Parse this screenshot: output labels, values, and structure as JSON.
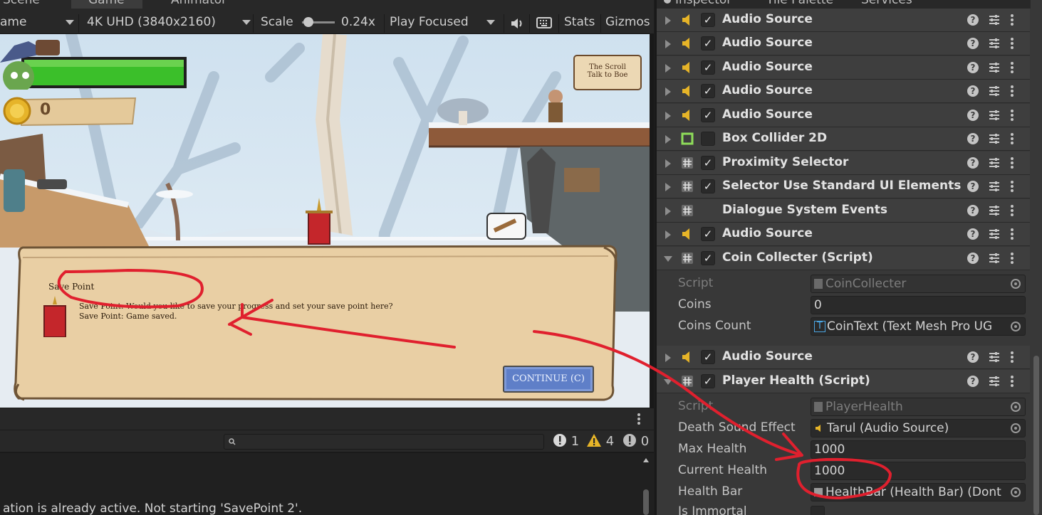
{
  "game_tabs": {
    "scene": "Scene",
    "game": "Game",
    "animator": "Animator"
  },
  "game_toolbar": {
    "display": "ame",
    "resolution": "4K UHD (3840x2160)",
    "scale_label": "Scale",
    "scale_value": "0.24x",
    "play_mode": "Play Focused",
    "stats": "Stats",
    "gizmos": "Gizmos"
  },
  "game_hud": {
    "coins": "0",
    "health_fraction": 1.0
  },
  "game_sign": {
    "line1": "The Scroll",
    "line2": "Talk to Boe"
  },
  "dialogue": {
    "speaker": "Save Point",
    "line1": "Save Point: Would you like to save your progress and set your save point here?",
    "line2": "Save Point: Game saved.",
    "continue": "CONTINUE (C)"
  },
  "console": {
    "counts": {
      "errors": "1",
      "warnings": "4",
      "messages": "0"
    },
    "last_line": "ation is already active. Not starting 'SavePoint 2'."
  },
  "inspector_tabs": {
    "inspector": "Inspector",
    "tile_palette": "Tile Palette",
    "services": "Services"
  },
  "components": [
    {
      "name": "Audio Source",
      "icon": "audio-icon",
      "checked": true
    },
    {
      "name": "Audio Source",
      "icon": "audio-icon",
      "checked": true
    },
    {
      "name": "Audio Source",
      "icon": "audio-icon",
      "checked": true
    },
    {
      "name": "Audio Source",
      "icon": "audio-icon",
      "checked": true
    },
    {
      "name": "Audio Source",
      "icon": "audio-icon",
      "checked": true
    },
    {
      "name": "Box Collider 2D",
      "icon": "box-collider-icon",
      "checked": false
    },
    {
      "name": "Proximity Selector",
      "icon": "script-icon",
      "checked": true
    },
    {
      "name": "Selector Use Standard UI Elements (",
      "icon": "script-icon",
      "checked": true
    },
    {
      "name": "Dialogue System Events",
      "icon": "script-icon",
      "checked": null
    },
    {
      "name": "Audio Source",
      "icon": "audio-icon",
      "checked": true
    },
    {
      "name": "Coin Collecter (Script)",
      "icon": "script-icon",
      "checked": true
    },
    {
      "name": "Audio Source",
      "icon": "audio-icon",
      "checked": true
    },
    {
      "name": "Player Health (Script)",
      "icon": "script-icon",
      "checked": true
    }
  ],
  "coin_collecter": {
    "script_label": "Script",
    "script_value": "CoinCollecter",
    "coins_label": "Coins",
    "coins_value": "0",
    "coins_count_label": "Coins Count",
    "coins_count_value": "CoinText (Text Mesh Pro UG"
  },
  "player_health": {
    "script_label": "Script",
    "script_value": "PlayerHealth",
    "death_sound_label": "Death Sound Effect",
    "death_sound_value": "Tarul (Audio Source)",
    "max_health_label": "Max Health",
    "max_health_value": "1000",
    "current_health_label": "Current Health",
    "current_health_value": "1000",
    "health_bar_label": "Health Bar",
    "health_bar_value": "HealthBar (Health Bar) (Dont",
    "is_immortal_label": "Is Immortal"
  },
  "colors": {
    "annotation": "#e0202e",
    "health_green": "#3bbf2a",
    "parchment": "#e9cfa4",
    "continue_blue": "#5f7fc8"
  }
}
